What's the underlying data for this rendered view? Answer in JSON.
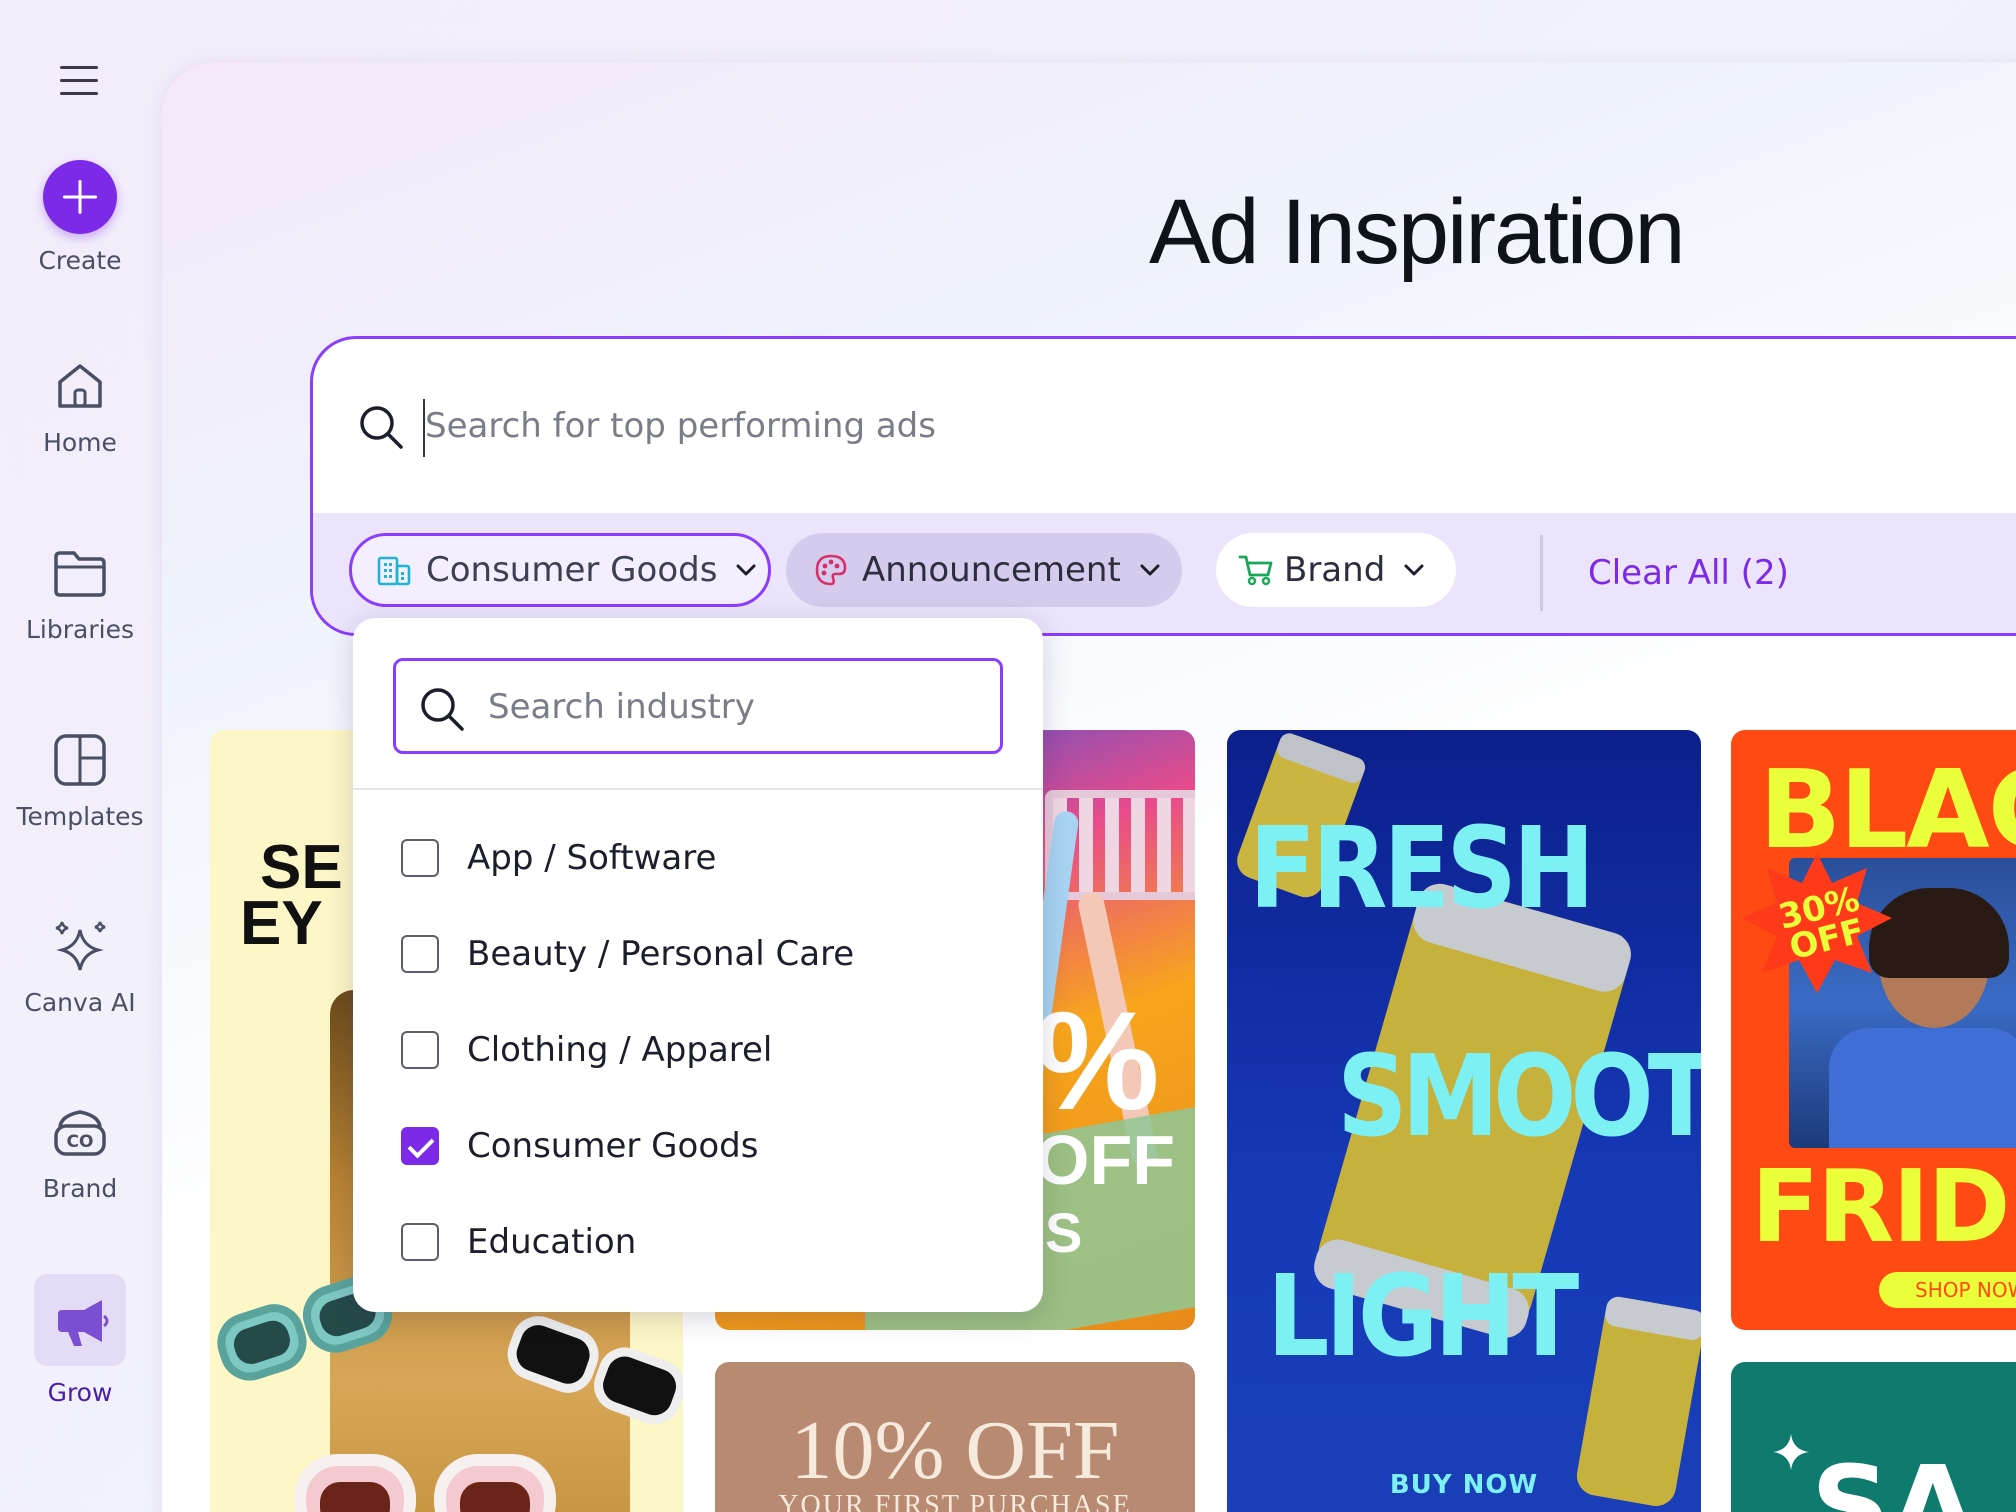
{
  "sidebar": {
    "create_label": "Create",
    "items": [
      {
        "label": "Home",
        "icon": "home-icon"
      },
      {
        "label": "Libraries",
        "icon": "folder-icon"
      },
      {
        "label": "Templates",
        "icon": "templates-icon"
      },
      {
        "label": "Canva AI",
        "icon": "sparkles-icon"
      },
      {
        "label": "Brand",
        "icon": "brand-icon"
      },
      {
        "label": "Grow",
        "icon": "megaphone-icon"
      }
    ],
    "active": "Grow"
  },
  "header": {
    "title": "Ad Inspiration"
  },
  "search": {
    "placeholder": "Search for top performing ads"
  },
  "filters": {
    "industry": "Consumer Goods",
    "type": "Announcement",
    "brand": "Brand",
    "clear_all": "Clear All (2)"
  },
  "dropdown": {
    "placeholder": "Search industry",
    "options": [
      {
        "label": "App / Software",
        "checked": false
      },
      {
        "label": "Beauty / Personal Care",
        "checked": false
      },
      {
        "label": "Clothing / Apparel",
        "checked": false
      },
      {
        "label": "Consumer Goods",
        "checked": true
      },
      {
        "label": "Education",
        "checked": false
      }
    ]
  },
  "ads": {
    "sunglasses": {
      "line1": "SE",
      "line2": "EY"
    },
    "basket": {
      "pct": "%",
      "off": "OFF",
      "s": "S"
    },
    "discount": {
      "big": "10% OFF",
      "small": "YOUR FIRST PURCHASE"
    },
    "drink": {
      "w1": "FRESH",
      "w2": "SMOOTH",
      "w3": "LIGHT",
      "cta": "BUY NOW"
    },
    "blackfriday": {
      "top": "BLAC",
      "bottom": "FRID",
      "badge1": "30%",
      "badge2": "OFF",
      "cta": "SHOP NOW"
    },
    "teal": {
      "text": "SA"
    }
  },
  "colors": {
    "accent": "#7d2ae8",
    "border": "#8b3dff",
    "drink_bg": "#0f2a8f",
    "drink_text": "#7df0f4",
    "bf_bg": "#ff4a14",
    "bf_text": "#eaff3a"
  }
}
